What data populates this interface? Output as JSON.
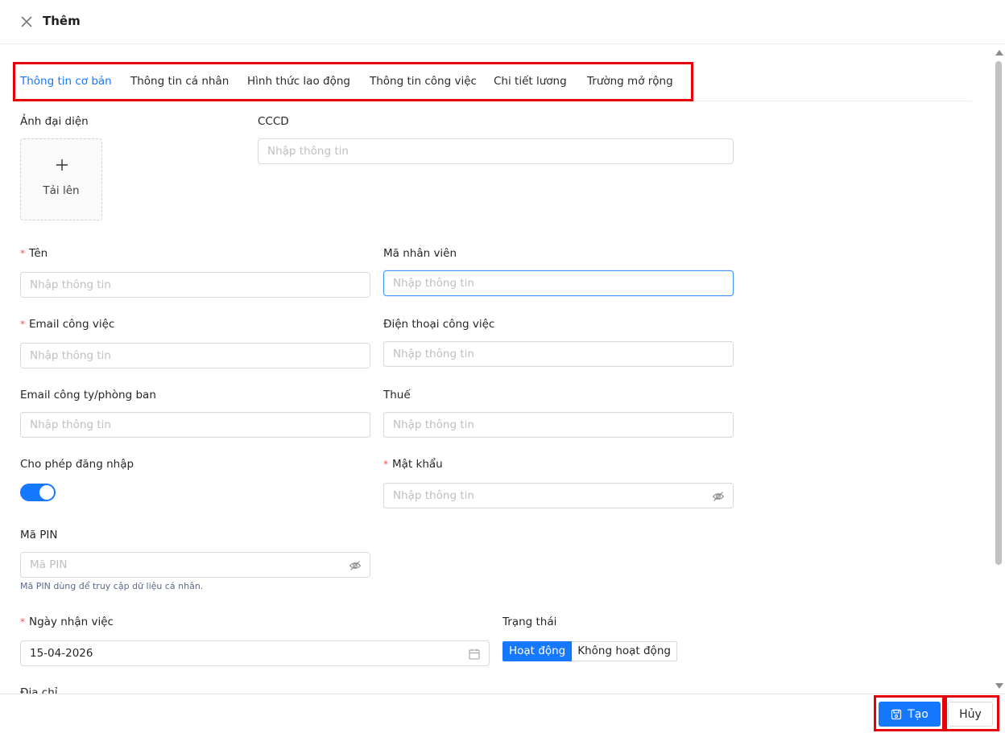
{
  "header": {
    "title": "Thêm"
  },
  "tabs": [
    {
      "label": "Thông tin cơ bản",
      "active": true
    },
    {
      "label": "Thông tin cá nhân"
    },
    {
      "label": "Hình thức lao động"
    },
    {
      "label": "Thông tin công việc"
    },
    {
      "label": "Chi tiết lương"
    },
    {
      "label": "Trường mở rộng"
    }
  ],
  "form": {
    "avatar": {
      "label": "Ảnh đại diện",
      "upload_text": "Tải lên"
    },
    "cccd": {
      "label": "CCCD",
      "placeholder": "Nhập thông tin"
    },
    "ten": {
      "label": "Tên",
      "placeholder": "Nhập thông tin"
    },
    "ma_nhan_vien": {
      "label": "Mã nhân viên",
      "placeholder": "Nhập thông tin"
    },
    "email_cong_viec": {
      "label": "Email công việc",
      "placeholder": "Nhập thông tin"
    },
    "dien_thoai_cong_viec": {
      "label": "Điện thoại công việc",
      "placeholder": "Nhập thông tin"
    },
    "email_cong_ty": {
      "label": "Email công ty/phòng ban",
      "placeholder": "Nhập thông tin"
    },
    "thue": {
      "label": "Thuế",
      "placeholder": "Nhập thông tin"
    },
    "cho_phep_dang_nhap": {
      "label": "Cho phép đăng nhập",
      "enabled": true
    },
    "mat_khau": {
      "label": "Mật khẩu",
      "placeholder": "Nhập thông tin"
    },
    "ma_pin": {
      "label": "Mã PIN",
      "placeholder": "Mã PIN",
      "help": "Mã PIN dùng để truy cập dữ liệu cá nhân."
    },
    "ngay_nhan_viec": {
      "label": "Ngày nhận việc",
      "value": "15-04-2026"
    },
    "trang_thai": {
      "label": "Trạng thái",
      "options": [
        "Hoạt động",
        "Không hoạt động"
      ],
      "selected": "Hoạt động"
    },
    "dia_chi": {
      "label": "Địa chỉ"
    },
    "required_mark": "*"
  },
  "footer": {
    "create_label": "Tạo",
    "cancel_label": "Hủy"
  },
  "colors": {
    "primary": "#1677ff",
    "highlight": "#e8000b",
    "required": "#ff4d4f"
  }
}
